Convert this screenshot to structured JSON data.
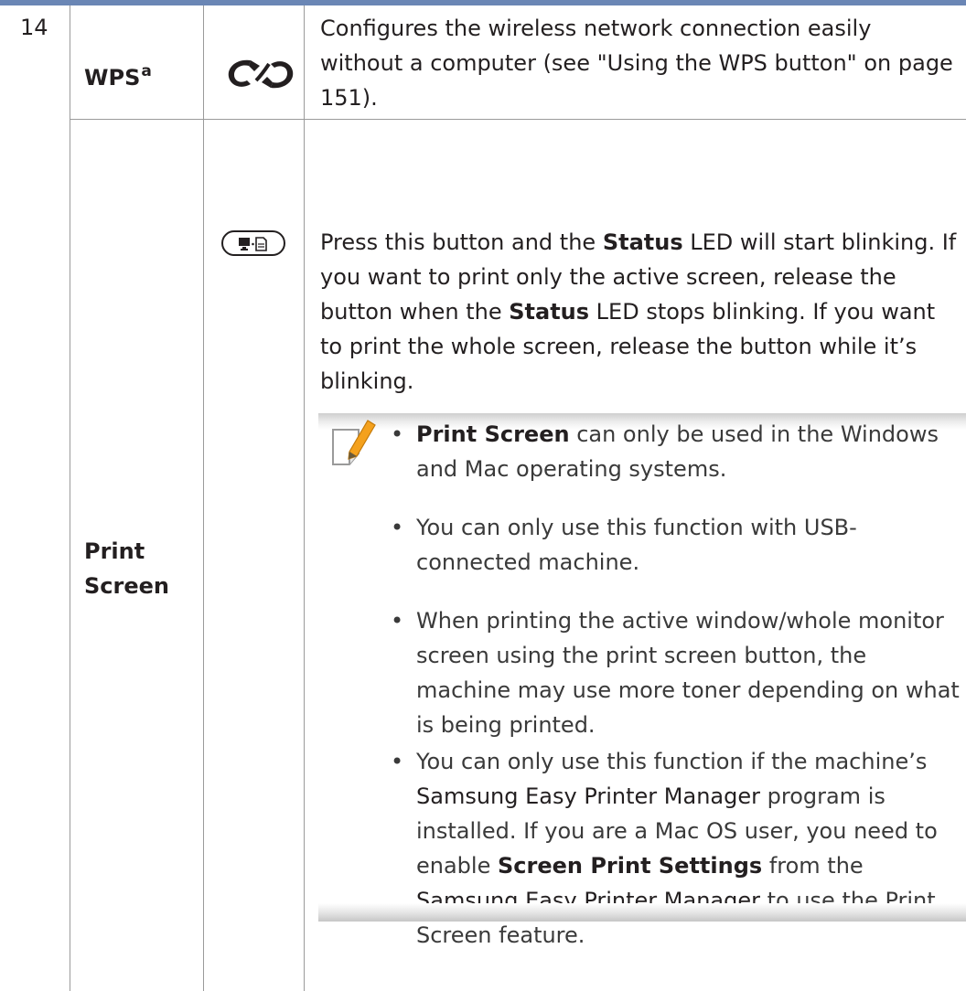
{
  "table": {
    "row_number": "14",
    "wps": {
      "label": "WPS",
      "footnote": "a",
      "icon": "wps-icon",
      "description": "Configures the wireless network connection easily without a computer (see \"Using the WPS button\" on page 151)."
    },
    "print_screen": {
      "label_line1": "Print",
      "label_line2": "Screen",
      "icon": "print-screen-icon",
      "desc": {
        "p1": "Press this button and the ",
        "status1": "Status",
        "p2": " LED will start blinking. If you want to print only the active screen, release the button when the ",
        "status2": "Status",
        "p3": " LED stops blinking. If you want to print the whole screen, release the button while it’s blinking."
      },
      "note": {
        "icon": "note-pencil-icon",
        "bullet_symbol": "•",
        "b1_bold": "Print Screen",
        "b1_text": " can only be used in the Windows and Mac operating systems.",
        "b2_text": "You can only use this function with USB-connected machine.",
        "b3_text": "When printing the active window/whole monitor screen using the print screen button, the machine may use more toner depending on what is being printed.",
        "b4_a": "You can only use this function if the machine’s ",
        "b4_b": "Samsung Easy Printer Manager",
        "b4_c": " program is installed. If you are a Mac OS user, you need to enable ",
        "b4_d": "Screen Print Settings",
        "b4_e": " from the ",
        "b4_f": "Samsung Easy Printer Manager",
        "b4_g": " to use the Print Screen feature."
      }
    }
  },
  "colors": {
    "top_rule": "#6a86b5",
    "grid_line": "#9a9a9a",
    "text": "#231f20",
    "note_text": "#3a3a3a",
    "pencil": "#f4a11d"
  }
}
